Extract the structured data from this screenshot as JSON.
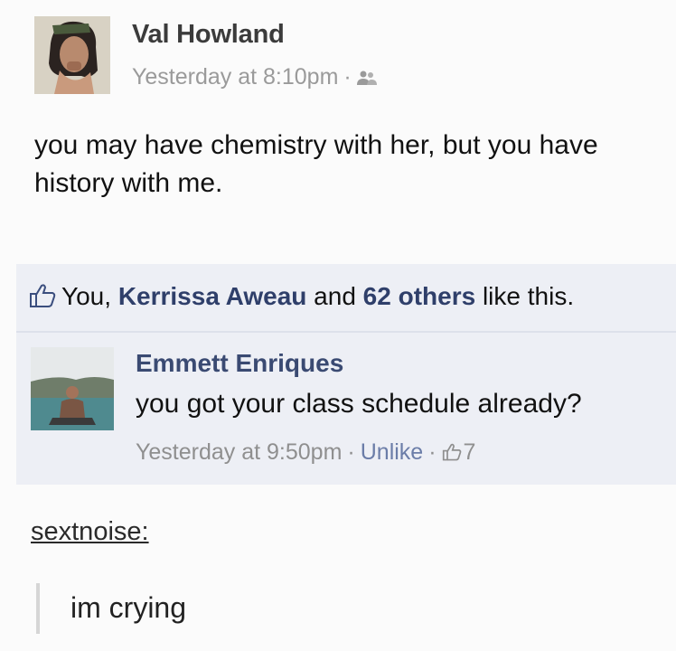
{
  "post": {
    "author": "Val Howland",
    "timestamp": "Yesterday at 8:10pm",
    "separator": "·",
    "audience_icon": "friends-icon",
    "text": "you may have chemistry with her, but you have history with me."
  },
  "likes": {
    "icon": "thumbs-up-icon",
    "you": "You,",
    "named_liker": "Kerrissa Aweau",
    "connector": "and",
    "others": "62 others",
    "suffix": "like this."
  },
  "comment": {
    "author": "Emmett Enriques",
    "text": "you got your class schedule already?",
    "timestamp": "Yesterday at 9:50pm",
    "separator": "·",
    "unlike_label": "Unlike",
    "like_count": "7"
  },
  "reblog": {
    "username": "sextnoise:",
    "reply": "im crying"
  },
  "colors": {
    "link_blue": "#3a4a72",
    "likes_background": "#edeff5",
    "meta_gray": "#9a9a9a"
  }
}
